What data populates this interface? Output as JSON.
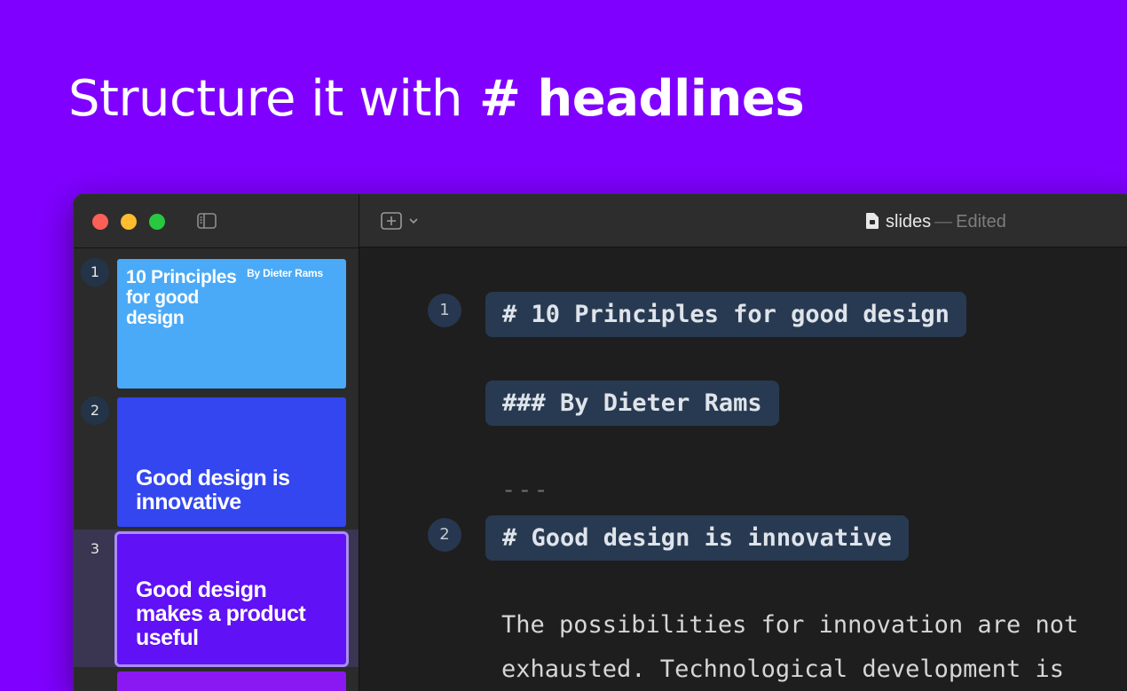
{
  "headline": {
    "light": "Structure it with",
    "bold": "# headlines"
  },
  "sidebar": {
    "slides": [
      {
        "number": "1",
        "title": "10 Principles for good design",
        "author": "By Dieter Rams",
        "color": "#4aaaf7"
      },
      {
        "number": "2",
        "title": "Good design is innovative",
        "color": "#3346f0"
      },
      {
        "number": "3",
        "title": "Good design makes a product useful",
        "color": "#6011f6",
        "selected": true
      }
    ]
  },
  "editor": {
    "document_name": "slides",
    "separator": "—",
    "status": "Edited",
    "lines": {
      "h1_first": "# 10 Principles for good design",
      "h3": "### By Dieter Rams",
      "divider": "---",
      "h1_second": "# Good design is innovative",
      "body_line1": "The possibilities for innovation are not",
      "body_line2": "exhausted. Technological development is"
    },
    "markers": [
      "1",
      "2"
    ]
  },
  "colors": {
    "background": "#7f00ff",
    "heading_chip": "#283a52",
    "marker": "#273750"
  }
}
